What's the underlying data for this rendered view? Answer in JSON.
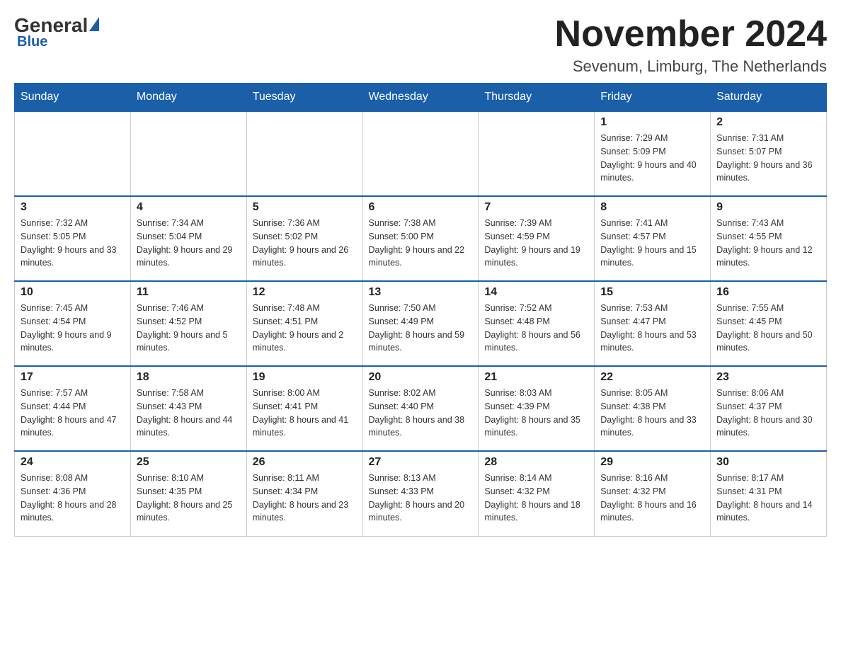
{
  "header": {
    "logo_general": "General",
    "logo_blue": "Blue",
    "month_title": "November 2024",
    "location": "Sevenum, Limburg, The Netherlands"
  },
  "weekdays": [
    "Sunday",
    "Monday",
    "Tuesday",
    "Wednesday",
    "Thursday",
    "Friday",
    "Saturday"
  ],
  "weeks": [
    [
      {
        "day": "",
        "info": ""
      },
      {
        "day": "",
        "info": ""
      },
      {
        "day": "",
        "info": ""
      },
      {
        "day": "",
        "info": ""
      },
      {
        "day": "",
        "info": ""
      },
      {
        "day": "1",
        "info": "Sunrise: 7:29 AM\nSunset: 5:09 PM\nDaylight: 9 hours and 40 minutes."
      },
      {
        "day": "2",
        "info": "Sunrise: 7:31 AM\nSunset: 5:07 PM\nDaylight: 9 hours and 36 minutes."
      }
    ],
    [
      {
        "day": "3",
        "info": "Sunrise: 7:32 AM\nSunset: 5:05 PM\nDaylight: 9 hours and 33 minutes."
      },
      {
        "day": "4",
        "info": "Sunrise: 7:34 AM\nSunset: 5:04 PM\nDaylight: 9 hours and 29 minutes."
      },
      {
        "day": "5",
        "info": "Sunrise: 7:36 AM\nSunset: 5:02 PM\nDaylight: 9 hours and 26 minutes."
      },
      {
        "day": "6",
        "info": "Sunrise: 7:38 AM\nSunset: 5:00 PM\nDaylight: 9 hours and 22 minutes."
      },
      {
        "day": "7",
        "info": "Sunrise: 7:39 AM\nSunset: 4:59 PM\nDaylight: 9 hours and 19 minutes."
      },
      {
        "day": "8",
        "info": "Sunrise: 7:41 AM\nSunset: 4:57 PM\nDaylight: 9 hours and 15 minutes."
      },
      {
        "day": "9",
        "info": "Sunrise: 7:43 AM\nSunset: 4:55 PM\nDaylight: 9 hours and 12 minutes."
      }
    ],
    [
      {
        "day": "10",
        "info": "Sunrise: 7:45 AM\nSunset: 4:54 PM\nDaylight: 9 hours and 9 minutes."
      },
      {
        "day": "11",
        "info": "Sunrise: 7:46 AM\nSunset: 4:52 PM\nDaylight: 9 hours and 5 minutes."
      },
      {
        "day": "12",
        "info": "Sunrise: 7:48 AM\nSunset: 4:51 PM\nDaylight: 9 hours and 2 minutes."
      },
      {
        "day": "13",
        "info": "Sunrise: 7:50 AM\nSunset: 4:49 PM\nDaylight: 8 hours and 59 minutes."
      },
      {
        "day": "14",
        "info": "Sunrise: 7:52 AM\nSunset: 4:48 PM\nDaylight: 8 hours and 56 minutes."
      },
      {
        "day": "15",
        "info": "Sunrise: 7:53 AM\nSunset: 4:47 PM\nDaylight: 8 hours and 53 minutes."
      },
      {
        "day": "16",
        "info": "Sunrise: 7:55 AM\nSunset: 4:45 PM\nDaylight: 8 hours and 50 minutes."
      }
    ],
    [
      {
        "day": "17",
        "info": "Sunrise: 7:57 AM\nSunset: 4:44 PM\nDaylight: 8 hours and 47 minutes."
      },
      {
        "day": "18",
        "info": "Sunrise: 7:58 AM\nSunset: 4:43 PM\nDaylight: 8 hours and 44 minutes."
      },
      {
        "day": "19",
        "info": "Sunrise: 8:00 AM\nSunset: 4:41 PM\nDaylight: 8 hours and 41 minutes."
      },
      {
        "day": "20",
        "info": "Sunrise: 8:02 AM\nSunset: 4:40 PM\nDaylight: 8 hours and 38 minutes."
      },
      {
        "day": "21",
        "info": "Sunrise: 8:03 AM\nSunset: 4:39 PM\nDaylight: 8 hours and 35 minutes."
      },
      {
        "day": "22",
        "info": "Sunrise: 8:05 AM\nSunset: 4:38 PM\nDaylight: 8 hours and 33 minutes."
      },
      {
        "day": "23",
        "info": "Sunrise: 8:06 AM\nSunset: 4:37 PM\nDaylight: 8 hours and 30 minutes."
      }
    ],
    [
      {
        "day": "24",
        "info": "Sunrise: 8:08 AM\nSunset: 4:36 PM\nDaylight: 8 hours and 28 minutes."
      },
      {
        "day": "25",
        "info": "Sunrise: 8:10 AM\nSunset: 4:35 PM\nDaylight: 8 hours and 25 minutes."
      },
      {
        "day": "26",
        "info": "Sunrise: 8:11 AM\nSunset: 4:34 PM\nDaylight: 8 hours and 23 minutes."
      },
      {
        "day": "27",
        "info": "Sunrise: 8:13 AM\nSunset: 4:33 PM\nDaylight: 8 hours and 20 minutes."
      },
      {
        "day": "28",
        "info": "Sunrise: 8:14 AM\nSunset: 4:32 PM\nDaylight: 8 hours and 18 minutes."
      },
      {
        "day": "29",
        "info": "Sunrise: 8:16 AM\nSunset: 4:32 PM\nDaylight: 8 hours and 16 minutes."
      },
      {
        "day": "30",
        "info": "Sunrise: 8:17 AM\nSunset: 4:31 PM\nDaylight: 8 hours and 14 minutes."
      }
    ]
  ]
}
